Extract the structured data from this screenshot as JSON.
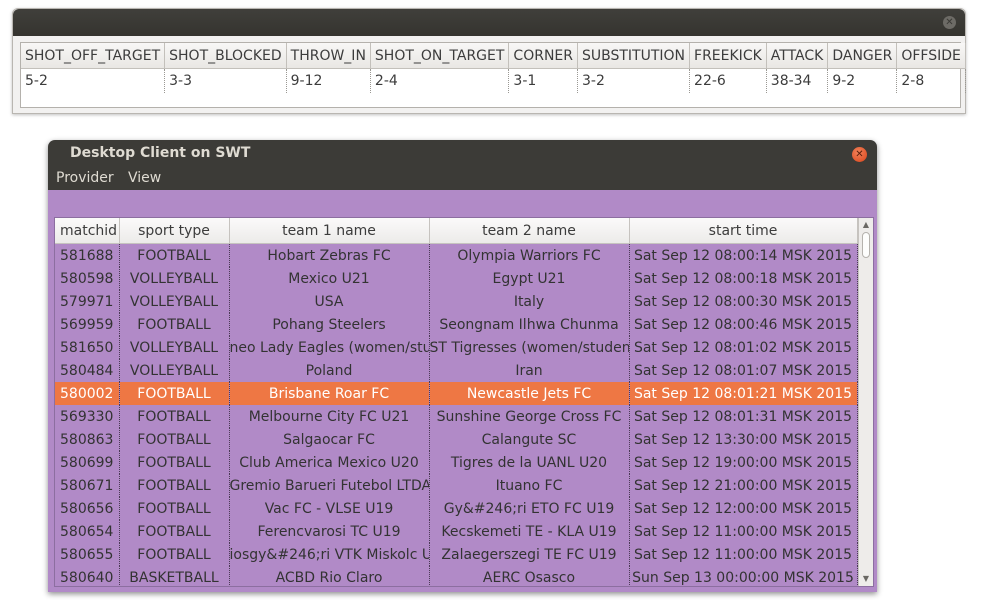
{
  "stats_window": {
    "close_icon": "close-icon",
    "headers": [
      "SHOT_OFF_TARGET",
      "SHOT_BLOCKED",
      "THROW_IN",
      "SHOT_ON_TARGET",
      "CORNER",
      "SUBSTITUTION",
      "FREEKICK",
      "ATTACK",
      "DANGER",
      "OFFSIDE"
    ],
    "values": [
      "5-2",
      "3-3",
      "9-12",
      "2-4",
      "3-1",
      "3-2",
      "22-6",
      "38-34",
      "9-2",
      "2-8"
    ]
  },
  "client_window": {
    "title": "Desktop Client on SWT",
    "close_icon": "close-icon",
    "menu": [
      "Provider",
      "View"
    ],
    "columns": [
      "matchid",
      "sport type",
      "team 1 name",
      "team 2 name",
      "start time"
    ],
    "selected_index": 6,
    "rows": [
      [
        "581688",
        "FOOTBALL",
        "Hobart Zebras FC",
        "Olympia Warriors FC",
        "Sat Sep 12 08:00:14 MSK 2015"
      ],
      [
        "580598",
        "VOLLEYBALL",
        "Mexico U21",
        "Egypt U21",
        "Sat Sep 12 08:00:18 MSK 2015"
      ],
      [
        "579971",
        "VOLLEYBALL",
        "USA",
        "Italy",
        "Sat Sep 12 08:00:30 MSK 2015"
      ],
      [
        "569959",
        "FOOTBALL",
        "Pohang Steelers",
        "Seongnam Ilhwa Chunma",
        "Sat Sep 12 08:00:46 MSK 2015"
      ],
      [
        "581650",
        "VOLLEYBALL",
        "neo Lady Eagles (women/stude",
        "ST Tigresses (women/student",
        "Sat Sep 12 08:01:02 MSK 2015"
      ],
      [
        "580484",
        "VOLLEYBALL",
        "Poland",
        "Iran",
        "Sat Sep 12 08:01:07 MSK 2015"
      ],
      [
        "580002",
        "FOOTBALL",
        "Brisbane Roar FC",
        "Newcastle Jets FC",
        "Sat Sep 12 08:01:21 MSK 2015"
      ],
      [
        "569330",
        "FOOTBALL",
        "Melbourne City FC U21",
        "Sunshine George Cross FC",
        "Sat Sep 12 08:01:31 MSK 2015"
      ],
      [
        "580863",
        "FOOTBALL",
        "Salgaocar FC",
        "Calangute SC",
        "Sat Sep 12 13:30:00 MSK 2015"
      ],
      [
        "580699",
        "FOOTBALL",
        "Club America Mexico U20",
        "Tigres de la UANL U20",
        "Sat Sep 12 19:00:00 MSK 2015"
      ],
      [
        "580671",
        "FOOTBALL",
        "Gremio Barueri Futebol LTDA",
        "Ituano FC",
        "Sat Sep 12 21:00:00 MSK 2015"
      ],
      [
        "580656",
        "FOOTBALL",
        "Vac FC - VLSE U19",
        "Gy&#246;ri ETO FC U19",
        "Sat Sep 12 12:00:00 MSK 2015"
      ],
      [
        "580654",
        "FOOTBALL",
        "Ferencvarosi TC U19",
        "Kecskemeti TE - KLA U19",
        "Sat Sep 12 11:00:00 MSK 2015"
      ],
      [
        "580655",
        "FOOTBALL",
        "iosgy&#246;ri VTK Miskolc U1",
        "Zalaegerszegi TE FC U19",
        "Sat Sep 12 11:00:00 MSK 2015"
      ],
      [
        "580640",
        "BASKETBALL",
        "ACBD Rio Claro",
        "AERC Osasco",
        "Sun Sep 13 00:00:00 MSK 2015"
      ]
    ]
  }
}
